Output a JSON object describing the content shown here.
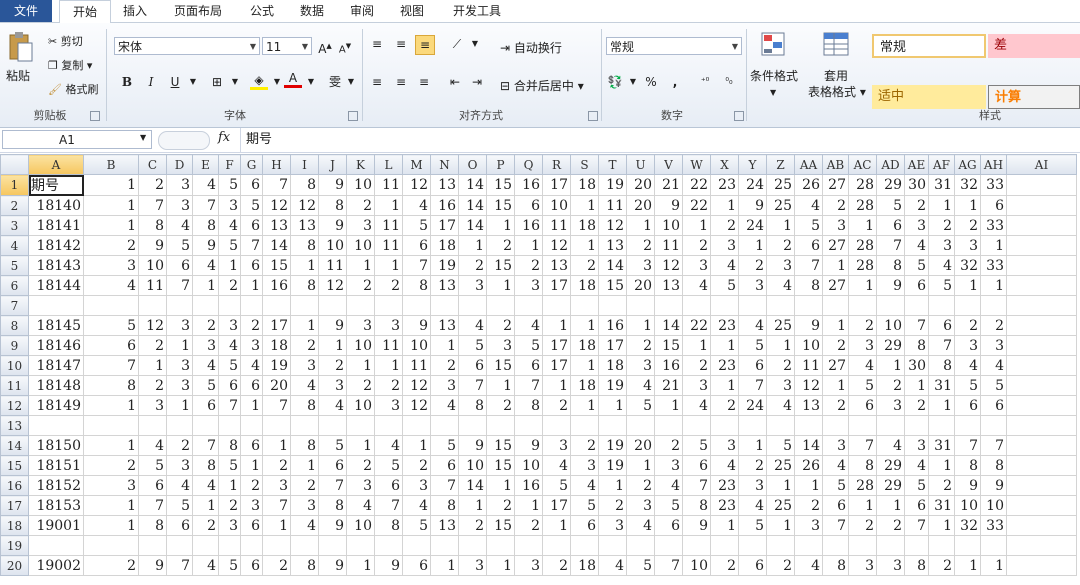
{
  "menu": {
    "tabs": [
      "文件",
      "开始",
      "插入",
      "页面布局",
      "公式",
      "数据",
      "审阅",
      "视图",
      "开发工具"
    ],
    "active": "开始"
  },
  "ribbon": {
    "clipboard": {
      "paste": "粘贴",
      "cut": "剪切",
      "copy": "复制",
      "format_painter": "格式刷",
      "label": "剪贴板"
    },
    "font": {
      "name": "宋体",
      "size": "11",
      "bold": "B",
      "italic": "I",
      "underline": "U",
      "label": "字体"
    },
    "align": {
      "wrap": "自动换行",
      "merge": "合并后居中",
      "label": "对齐方式"
    },
    "number": {
      "format": "常规",
      "label": "数字"
    },
    "styles": {
      "cond_format": "条件格式",
      "table_format_1": "套用",
      "table_format_2": "表格格式",
      "normal": "常规",
      "bad": "差",
      "neutral": "适中",
      "calc": "计算",
      "label": "样式"
    }
  },
  "formula_bar": {
    "name_box": "A1",
    "fx": "fx",
    "content": "期号"
  },
  "columns": [
    "A",
    "B",
    "C",
    "D",
    "E",
    "F",
    "G",
    "H",
    "I",
    "J",
    "K",
    "L",
    "M",
    "N",
    "O",
    "P",
    "Q",
    "R",
    "S",
    "T",
    "U",
    "V",
    "W",
    "X",
    "Y",
    "Z",
    "AA",
    "AB",
    "AC",
    "AD",
    "AE",
    "AF",
    "AG",
    "AH",
    "AI"
  ],
  "rows": [
    {
      "n": "1",
      "cells": [
        "期号",
        "1",
        "2",
        "3",
        "4",
        "5",
        "6",
        "7",
        "8",
        "9",
        "10",
        "11",
        "12",
        "13",
        "14",
        "15",
        "16",
        "17",
        "18",
        "19",
        "20",
        "21",
        "22",
        "23",
        "24",
        "25",
        "26",
        "27",
        "28",
        "29",
        "30",
        "31",
        "32",
        "33"
      ]
    },
    {
      "n": "2",
      "cells": [
        "18140",
        "1",
        "7",
        "3",
        "7",
        "3",
        "5",
        "12",
        "12",
        "8",
        "2",
        "1",
        "4",
        "16",
        "14",
        "15",
        "6",
        "10",
        "1",
        "11",
        "20",
        "9",
        "22",
        "1",
        "9",
        "25",
        "4",
        "2",
        "28",
        "5",
        "2",
        "1",
        "1",
        "6"
      ]
    },
    {
      "n": "3",
      "cells": [
        "18141",
        "1",
        "8",
        "4",
        "8",
        "4",
        "6",
        "13",
        "13",
        "9",
        "3",
        "11",
        "5",
        "17",
        "14",
        "1",
        "16",
        "11",
        "18",
        "12",
        "1",
        "10",
        "1",
        "2",
        "24",
        "1",
        "5",
        "3",
        "1",
        "6",
        "3",
        "2",
        "2",
        "33"
      ]
    },
    {
      "n": "4",
      "cells": [
        "18142",
        "2",
        "9",
        "5",
        "9",
        "5",
        "7",
        "14",
        "8",
        "10",
        "10",
        "11",
        "6",
        "18",
        "1",
        "2",
        "1",
        "12",
        "1",
        "13",
        "2",
        "11",
        "2",
        "3",
        "1",
        "2",
        "6",
        "27",
        "28",
        "7",
        "4",
        "3",
        "3",
        "1"
      ]
    },
    {
      "n": "5",
      "cells": [
        "18143",
        "3",
        "10",
        "6",
        "4",
        "1",
        "6",
        "15",
        "1",
        "11",
        "1",
        "1",
        "7",
        "19",
        "2",
        "15",
        "2",
        "13",
        "2",
        "14",
        "3",
        "12",
        "3",
        "4",
        "2",
        "3",
        "7",
        "1",
        "28",
        "8",
        "5",
        "4",
        "32",
        "33"
      ]
    },
    {
      "n": "6",
      "cells": [
        "18144",
        "4",
        "11",
        "7",
        "1",
        "2",
        "1",
        "16",
        "8",
        "12",
        "2",
        "2",
        "8",
        "13",
        "3",
        "1",
        "3",
        "17",
        "18",
        "15",
        "20",
        "13",
        "4",
        "5",
        "3",
        "4",
        "8",
        "27",
        "1",
        "9",
        "6",
        "5",
        "1",
        "1"
      ]
    },
    {
      "n": "7",
      "cells": []
    },
    {
      "n": "8",
      "cells": [
        "18145",
        "5",
        "12",
        "3",
        "2",
        "3",
        "2",
        "17",
        "1",
        "9",
        "3",
        "3",
        "9",
        "13",
        "4",
        "2",
        "4",
        "1",
        "1",
        "16",
        "1",
        "14",
        "22",
        "23",
        "4",
        "25",
        "9",
        "1",
        "2",
        "10",
        "7",
        "6",
        "2",
        "2"
      ]
    },
    {
      "n": "9",
      "cells": [
        "18146",
        "6",
        "2",
        "1",
        "3",
        "4",
        "3",
        "18",
        "2",
        "1",
        "10",
        "11",
        "10",
        "1",
        "5",
        "3",
        "5",
        "17",
        "18",
        "17",
        "2",
        "15",
        "1",
        "1",
        "5",
        "1",
        "10",
        "2",
        "3",
        "29",
        "8",
        "7",
        "3",
        "3"
      ]
    },
    {
      "n": "10",
      "cells": [
        "18147",
        "7",
        "1",
        "3",
        "4",
        "5",
        "4",
        "19",
        "3",
        "2",
        "1",
        "1",
        "11",
        "2",
        "6",
        "15",
        "6",
        "17",
        "1",
        "18",
        "3",
        "16",
        "2",
        "23",
        "6",
        "2",
        "11",
        "27",
        "4",
        "1",
        "30",
        "8",
        "4",
        "4"
      ]
    },
    {
      "n": "11",
      "cells": [
        "18148",
        "8",
        "2",
        "3",
        "5",
        "6",
        "6",
        "20",
        "4",
        "3",
        "2",
        "2",
        "12",
        "3",
        "7",
        "1",
        "7",
        "1",
        "18",
        "19",
        "4",
        "21",
        "3",
        "1",
        "7",
        "3",
        "12",
        "1",
        "5",
        "2",
        "1",
        "31",
        "5",
        "5"
      ]
    },
    {
      "n": "12",
      "cells": [
        "18149",
        "1",
        "3",
        "1",
        "6",
        "7",
        "1",
        "7",
        "8",
        "4",
        "10",
        "3",
        "12",
        "4",
        "8",
        "2",
        "8",
        "2",
        "1",
        "1",
        "5",
        "1",
        "4",
        "2",
        "24",
        "4",
        "13",
        "2",
        "6",
        "3",
        "2",
        "1",
        "6",
        "6"
      ]
    },
    {
      "n": "13",
      "cells": []
    },
    {
      "n": "14",
      "cells": [
        "18150",
        "1",
        "4",
        "2",
        "7",
        "8",
        "6",
        "1",
        "8",
        "5",
        "1",
        "4",
        "1",
        "5",
        "9",
        "15",
        "9",
        "3",
        "2",
        "19",
        "20",
        "2",
        "5",
        "3",
        "1",
        "5",
        "14",
        "3",
        "7",
        "4",
        "3",
        "31",
        "7",
        "7"
      ]
    },
    {
      "n": "15",
      "cells": [
        "18151",
        "2",
        "5",
        "3",
        "8",
        "5",
        "1",
        "2",
        "1",
        "6",
        "2",
        "5",
        "2",
        "6",
        "10",
        "15",
        "10",
        "4",
        "3",
        "19",
        "1",
        "3",
        "6",
        "4",
        "2",
        "25",
        "26",
        "4",
        "8",
        "29",
        "4",
        "1",
        "8",
        "8"
      ]
    },
    {
      "n": "16",
      "cells": [
        "18152",
        "3",
        "6",
        "4",
        "4",
        "1",
        "2",
        "3",
        "2",
        "7",
        "3",
        "6",
        "3",
        "7",
        "14",
        "1",
        "16",
        "5",
        "4",
        "1",
        "2",
        "4",
        "7",
        "23",
        "3",
        "1",
        "1",
        "5",
        "28",
        "29",
        "5",
        "2",
        "9",
        "9"
      ]
    },
    {
      "n": "17",
      "cells": [
        "18153",
        "1",
        "7",
        "5",
        "1",
        "2",
        "3",
        "7",
        "3",
        "8",
        "4",
        "7",
        "4",
        "8",
        "1",
        "2",
        "1",
        "17",
        "5",
        "2",
        "3",
        "5",
        "8",
        "23",
        "4",
        "25",
        "2",
        "6",
        "1",
        "1",
        "6",
        "31",
        "10",
        "10"
      ]
    },
    {
      "n": "18",
      "cells": [
        "19001",
        "1",
        "8",
        "6",
        "2",
        "3",
        "6",
        "1",
        "4",
        "9",
        "10",
        "8",
        "5",
        "13",
        "2",
        "15",
        "2",
        "1",
        "6",
        "3",
        "4",
        "6",
        "9",
        "1",
        "5",
        "1",
        "3",
        "7",
        "2",
        "2",
        "7",
        "1",
        "32",
        "33"
      ]
    },
    {
      "n": "19",
      "cells": []
    },
    {
      "n": "20",
      "cells": [
        "19002",
        "2",
        "9",
        "7",
        "4",
        "5",
        "6",
        "2",
        "8",
        "9",
        "1",
        "9",
        "6",
        "1",
        "3",
        "1",
        "3",
        "2",
        "18",
        "4",
        "5",
        "7",
        "10",
        "2",
        "6",
        "2",
        "4",
        "8",
        "3",
        "3",
        "8",
        "2",
        "1",
        "1"
      ]
    }
  ]
}
